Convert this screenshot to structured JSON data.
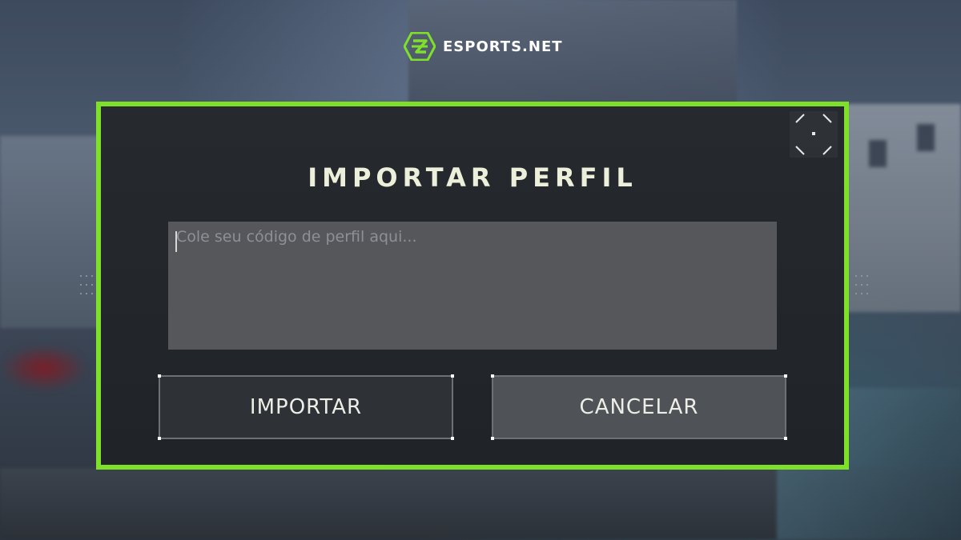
{
  "brand": {
    "name": "ESPORTS.NET",
    "logo_icon": "esports-net-logo-icon",
    "accent_color": "#7fe02a"
  },
  "dialog": {
    "title": "IMPORTAR PERFIL",
    "input_placeholder": "Cole seu código de perfil aqui...",
    "input_value": "",
    "import_label": "IMPORTAR",
    "cancel_label": "CANCELAR",
    "expand_icon": "expand-icon",
    "border_color": "#7fe02a"
  }
}
